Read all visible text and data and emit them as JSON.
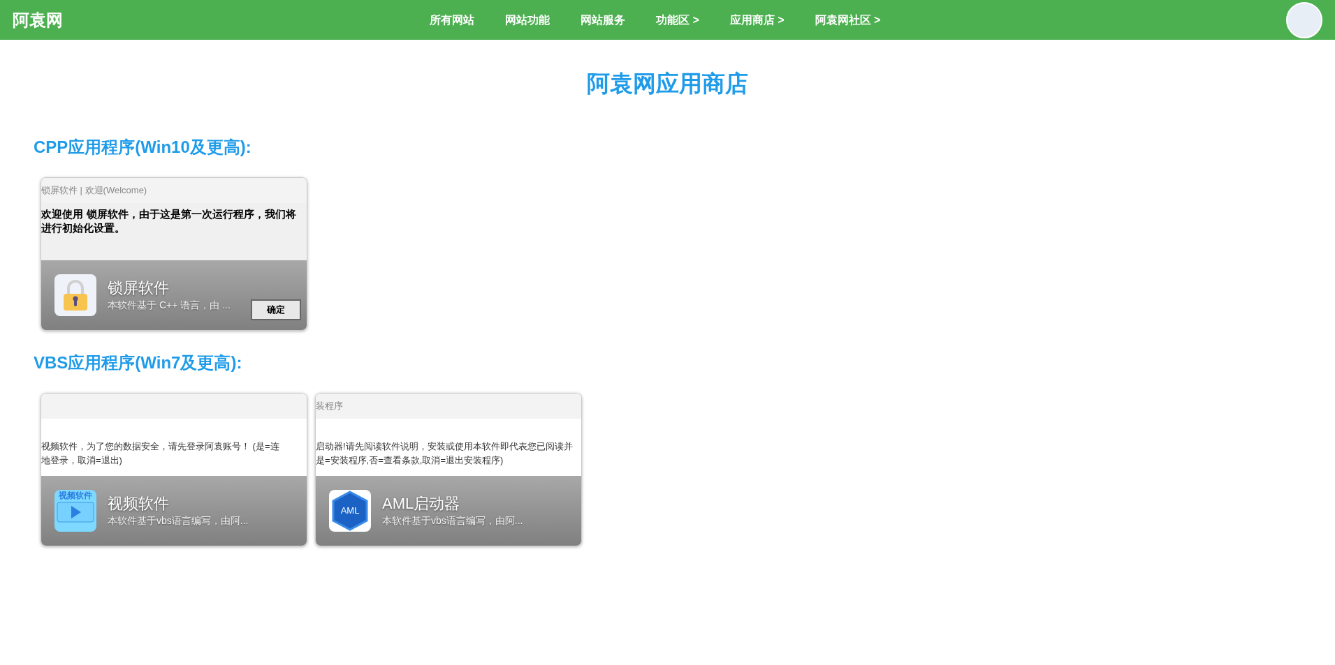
{
  "header": {
    "logo": "阿袁网",
    "nav": [
      {
        "label": "所有网站"
      },
      {
        "label": "网站功能"
      },
      {
        "label": "网站服务"
      },
      {
        "label": "功能区 >"
      },
      {
        "label": "应用商店 >"
      },
      {
        "label": "阿袁网社区 >"
      }
    ]
  },
  "page_title": "阿袁网应用商店",
  "sections": [
    {
      "heading": "CPP应用程序(Win10及更高):",
      "apps": [
        {
          "name": "锁屏软件",
          "description": "本软件基于 C++ 语言，由 ...",
          "icon": {
            "kind": "lock"
          },
          "preview": {
            "kind": "console",
            "title": "锁屏软件 | 欢迎(Welcome)",
            "message": "欢迎使用 锁屏软件，由于这是第一次运行程序，我们将进行初始化设置。",
            "buttons": [
              "确定"
            ]
          }
        }
      ]
    },
    {
      "heading": "VBS应用程序(Win7及更高):",
      "apps": [
        {
          "name": "视频软件",
          "description": "本软件基于vbs语言编写，由阿...",
          "icon": {
            "kind": "video",
            "label": "视频软件"
          },
          "preview": {
            "kind": "message_box",
            "message": "视频软件，为了您的数据安全，请先登录阿袁账号！ (是=连",
            "message_2": "地登录，取消=退出)"
          }
        },
        {
          "name": "AML启动器",
          "description": "本软件基于vbs语言编写，由阿...",
          "icon": {
            "kind": "hexagon",
            "label": "AML"
          },
          "preview": {
            "kind": "message_box",
            "title": "装程序",
            "message": "启动器!请先阅读软件说明，安装或使用本软件即代表您已阅读并",
            "message_2": "是=安装程序,否=查看条款,取消=退出安装程序)"
          }
        }
      ]
    }
  ]
}
